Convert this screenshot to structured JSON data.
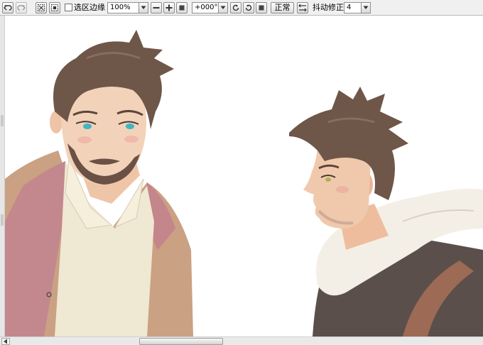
{
  "toolbar": {
    "selection_edge_label": "选区边缘",
    "zoom_value": "100%",
    "rotation_value": "+000°",
    "blend_mode_label": "正常",
    "stabilizer_label": "抖动修正",
    "stabilizer_value": "4"
  },
  "colors": {
    "toolbar_bg": "#f0f0f0",
    "canvas_bg": "#ffffff",
    "hair": "#6e5648",
    "skin": "#f2d2b8",
    "coat": "#c78f8f",
    "eyes_left": "#3fb6c4",
    "eyes_right": "#a7b45a"
  }
}
